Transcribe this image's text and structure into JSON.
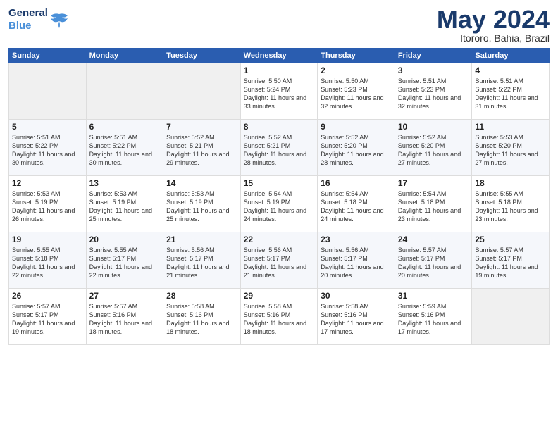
{
  "header": {
    "logo_general": "General",
    "logo_blue": "Blue",
    "month_title": "May 2024",
    "location": "Itororo, Bahia, Brazil"
  },
  "weekdays": [
    "Sunday",
    "Monday",
    "Tuesday",
    "Wednesday",
    "Thursday",
    "Friday",
    "Saturday"
  ],
  "weeks": [
    [
      {
        "day": "",
        "empty": true
      },
      {
        "day": "",
        "empty": true
      },
      {
        "day": "",
        "empty": true
      },
      {
        "day": "1",
        "sunrise": "5:50 AM",
        "sunset": "5:24 PM",
        "daylight": "11 hours and 33 minutes."
      },
      {
        "day": "2",
        "sunrise": "5:50 AM",
        "sunset": "5:23 PM",
        "daylight": "11 hours and 32 minutes."
      },
      {
        "day": "3",
        "sunrise": "5:51 AM",
        "sunset": "5:23 PM",
        "daylight": "11 hours and 32 minutes."
      },
      {
        "day": "4",
        "sunrise": "5:51 AM",
        "sunset": "5:22 PM",
        "daylight": "11 hours and 31 minutes."
      }
    ],
    [
      {
        "day": "5",
        "sunrise": "5:51 AM",
        "sunset": "5:22 PM",
        "daylight": "11 hours and 30 minutes."
      },
      {
        "day": "6",
        "sunrise": "5:51 AM",
        "sunset": "5:22 PM",
        "daylight": "11 hours and 30 minutes."
      },
      {
        "day": "7",
        "sunrise": "5:52 AM",
        "sunset": "5:21 PM",
        "daylight": "11 hours and 29 minutes."
      },
      {
        "day": "8",
        "sunrise": "5:52 AM",
        "sunset": "5:21 PM",
        "daylight": "11 hours and 28 minutes."
      },
      {
        "day": "9",
        "sunrise": "5:52 AM",
        "sunset": "5:20 PM",
        "daylight": "11 hours and 28 minutes."
      },
      {
        "day": "10",
        "sunrise": "5:52 AM",
        "sunset": "5:20 PM",
        "daylight": "11 hours and 27 minutes."
      },
      {
        "day": "11",
        "sunrise": "5:53 AM",
        "sunset": "5:20 PM",
        "daylight": "11 hours and 27 minutes."
      }
    ],
    [
      {
        "day": "12",
        "sunrise": "5:53 AM",
        "sunset": "5:19 PM",
        "daylight": "11 hours and 26 minutes."
      },
      {
        "day": "13",
        "sunrise": "5:53 AM",
        "sunset": "5:19 PM",
        "daylight": "11 hours and 25 minutes."
      },
      {
        "day": "14",
        "sunrise": "5:53 AM",
        "sunset": "5:19 PM",
        "daylight": "11 hours and 25 minutes."
      },
      {
        "day": "15",
        "sunrise": "5:54 AM",
        "sunset": "5:19 PM",
        "daylight": "11 hours and 24 minutes."
      },
      {
        "day": "16",
        "sunrise": "5:54 AM",
        "sunset": "5:18 PM",
        "daylight": "11 hours and 24 minutes."
      },
      {
        "day": "17",
        "sunrise": "5:54 AM",
        "sunset": "5:18 PM",
        "daylight": "11 hours and 23 minutes."
      },
      {
        "day": "18",
        "sunrise": "5:55 AM",
        "sunset": "5:18 PM",
        "daylight": "11 hours and 23 minutes."
      }
    ],
    [
      {
        "day": "19",
        "sunrise": "5:55 AM",
        "sunset": "5:18 PM",
        "daylight": "11 hours and 22 minutes."
      },
      {
        "day": "20",
        "sunrise": "5:55 AM",
        "sunset": "5:17 PM",
        "daylight": "11 hours and 22 minutes."
      },
      {
        "day": "21",
        "sunrise": "5:56 AM",
        "sunset": "5:17 PM",
        "daylight": "11 hours and 21 minutes."
      },
      {
        "day": "22",
        "sunrise": "5:56 AM",
        "sunset": "5:17 PM",
        "daylight": "11 hours and 21 minutes."
      },
      {
        "day": "23",
        "sunrise": "5:56 AM",
        "sunset": "5:17 PM",
        "daylight": "11 hours and 20 minutes."
      },
      {
        "day": "24",
        "sunrise": "5:57 AM",
        "sunset": "5:17 PM",
        "daylight": "11 hours and 20 minutes."
      },
      {
        "day": "25",
        "sunrise": "5:57 AM",
        "sunset": "5:17 PM",
        "daylight": "11 hours and 19 minutes."
      }
    ],
    [
      {
        "day": "26",
        "sunrise": "5:57 AM",
        "sunset": "5:17 PM",
        "daylight": "11 hours and 19 minutes."
      },
      {
        "day": "27",
        "sunrise": "5:57 AM",
        "sunset": "5:16 PM",
        "daylight": "11 hours and 18 minutes."
      },
      {
        "day": "28",
        "sunrise": "5:58 AM",
        "sunset": "5:16 PM",
        "daylight": "11 hours and 18 minutes."
      },
      {
        "day": "29",
        "sunrise": "5:58 AM",
        "sunset": "5:16 PM",
        "daylight": "11 hours and 18 minutes."
      },
      {
        "day": "30",
        "sunrise": "5:58 AM",
        "sunset": "5:16 PM",
        "daylight": "11 hours and 17 minutes."
      },
      {
        "day": "31",
        "sunrise": "5:59 AM",
        "sunset": "5:16 PM",
        "daylight": "11 hours and 17 minutes."
      },
      {
        "day": "",
        "empty": true
      }
    ]
  ],
  "labels": {
    "sunrise": "Sunrise:",
    "sunset": "Sunset:",
    "daylight": "Daylight:"
  }
}
